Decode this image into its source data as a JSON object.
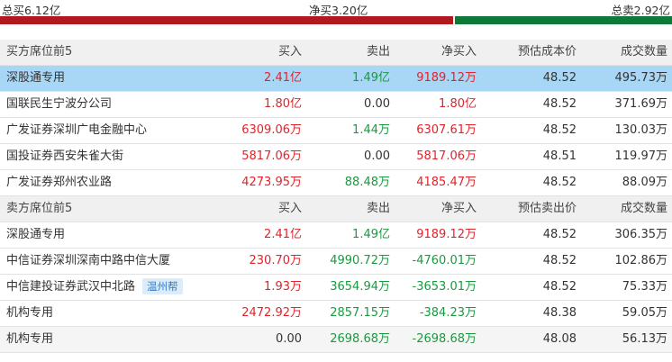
{
  "summary": {
    "total_buy": "总买6.12亿",
    "net_buy": "净买3.20亿",
    "total_sell": "总卖2.92亿"
  },
  "colors": {
    "up": "#e0242b",
    "down": "#1a9a3f",
    "buy_bar": "#b01a1f",
    "sell_bar": "#0f7a37",
    "highlight": "#a8d7f5"
  },
  "buy_section": {
    "headers": [
      "买方席位前5",
      "买入",
      "卖出",
      "净买入",
      "预估成本价",
      "成交数量"
    ],
    "rows": [
      {
        "name": "深股通专用",
        "buy": "2.41亿",
        "sell": "1.49亿",
        "net": "9189.12万",
        "price": "48.52",
        "volume": "495.73万",
        "buy_c": "red",
        "sell_c": "green",
        "net_c": "red"
      },
      {
        "name": "国联民生宁波分公司",
        "buy": "1.80亿",
        "sell": "0.00",
        "net": "1.80亿",
        "price": "48.52",
        "volume": "371.69万",
        "buy_c": "red",
        "sell_c": "black",
        "net_c": "red"
      },
      {
        "name": "广发证券深圳广电金融中心",
        "buy": "6309.06万",
        "sell": "1.44万",
        "net": "6307.61万",
        "price": "48.52",
        "volume": "130.03万",
        "buy_c": "red",
        "sell_c": "green",
        "net_c": "red"
      },
      {
        "name": "国投证券西安朱雀大街",
        "buy": "5817.06万",
        "sell": "0.00",
        "net": "5817.06万",
        "price": "48.51",
        "volume": "119.97万",
        "buy_c": "red",
        "sell_c": "black",
        "net_c": "red"
      },
      {
        "name": "广发证券郑州农业路",
        "buy": "4273.95万",
        "sell": "88.48万",
        "net": "4185.47万",
        "price": "48.52",
        "volume": "88.09万",
        "buy_c": "red",
        "sell_c": "green",
        "net_c": "red"
      }
    ]
  },
  "sell_section": {
    "headers": [
      "卖方席位前5",
      "买入",
      "卖出",
      "净买入",
      "预估卖出价",
      "成交数量"
    ],
    "rows": [
      {
        "name": "深股通专用",
        "buy": "2.41亿",
        "sell": "1.49亿",
        "net": "9189.12万",
        "price": "48.52",
        "volume": "306.35万",
        "buy_c": "red",
        "sell_c": "green",
        "net_c": "red"
      },
      {
        "name": "中信证券深圳深南中路中信大厦",
        "buy": "230.70万",
        "sell": "4990.72万",
        "net": "-4760.01万",
        "price": "48.52",
        "volume": "102.86万",
        "buy_c": "red",
        "sell_c": "green",
        "net_c": "green"
      },
      {
        "name": "中信建投证券武汉中北路",
        "tag": "温州帮",
        "buy": "1.93万",
        "sell": "3654.94万",
        "net": "-3653.01万",
        "price": "48.52",
        "volume": "75.33万",
        "buy_c": "red",
        "sell_c": "green",
        "net_c": "green"
      },
      {
        "name": "机构专用",
        "buy": "2472.92万",
        "sell": "2857.15万",
        "net": "-384.23万",
        "price": "48.38",
        "volume": "59.05万",
        "buy_c": "red",
        "sell_c": "green",
        "net_c": "green"
      },
      {
        "name": "机构专用",
        "buy": "0.00",
        "sell": "2698.68万",
        "net": "-2698.68万",
        "price": "48.08",
        "volume": "56.13万",
        "buy_c": "black",
        "sell_c": "green",
        "net_c": "green"
      }
    ]
  }
}
